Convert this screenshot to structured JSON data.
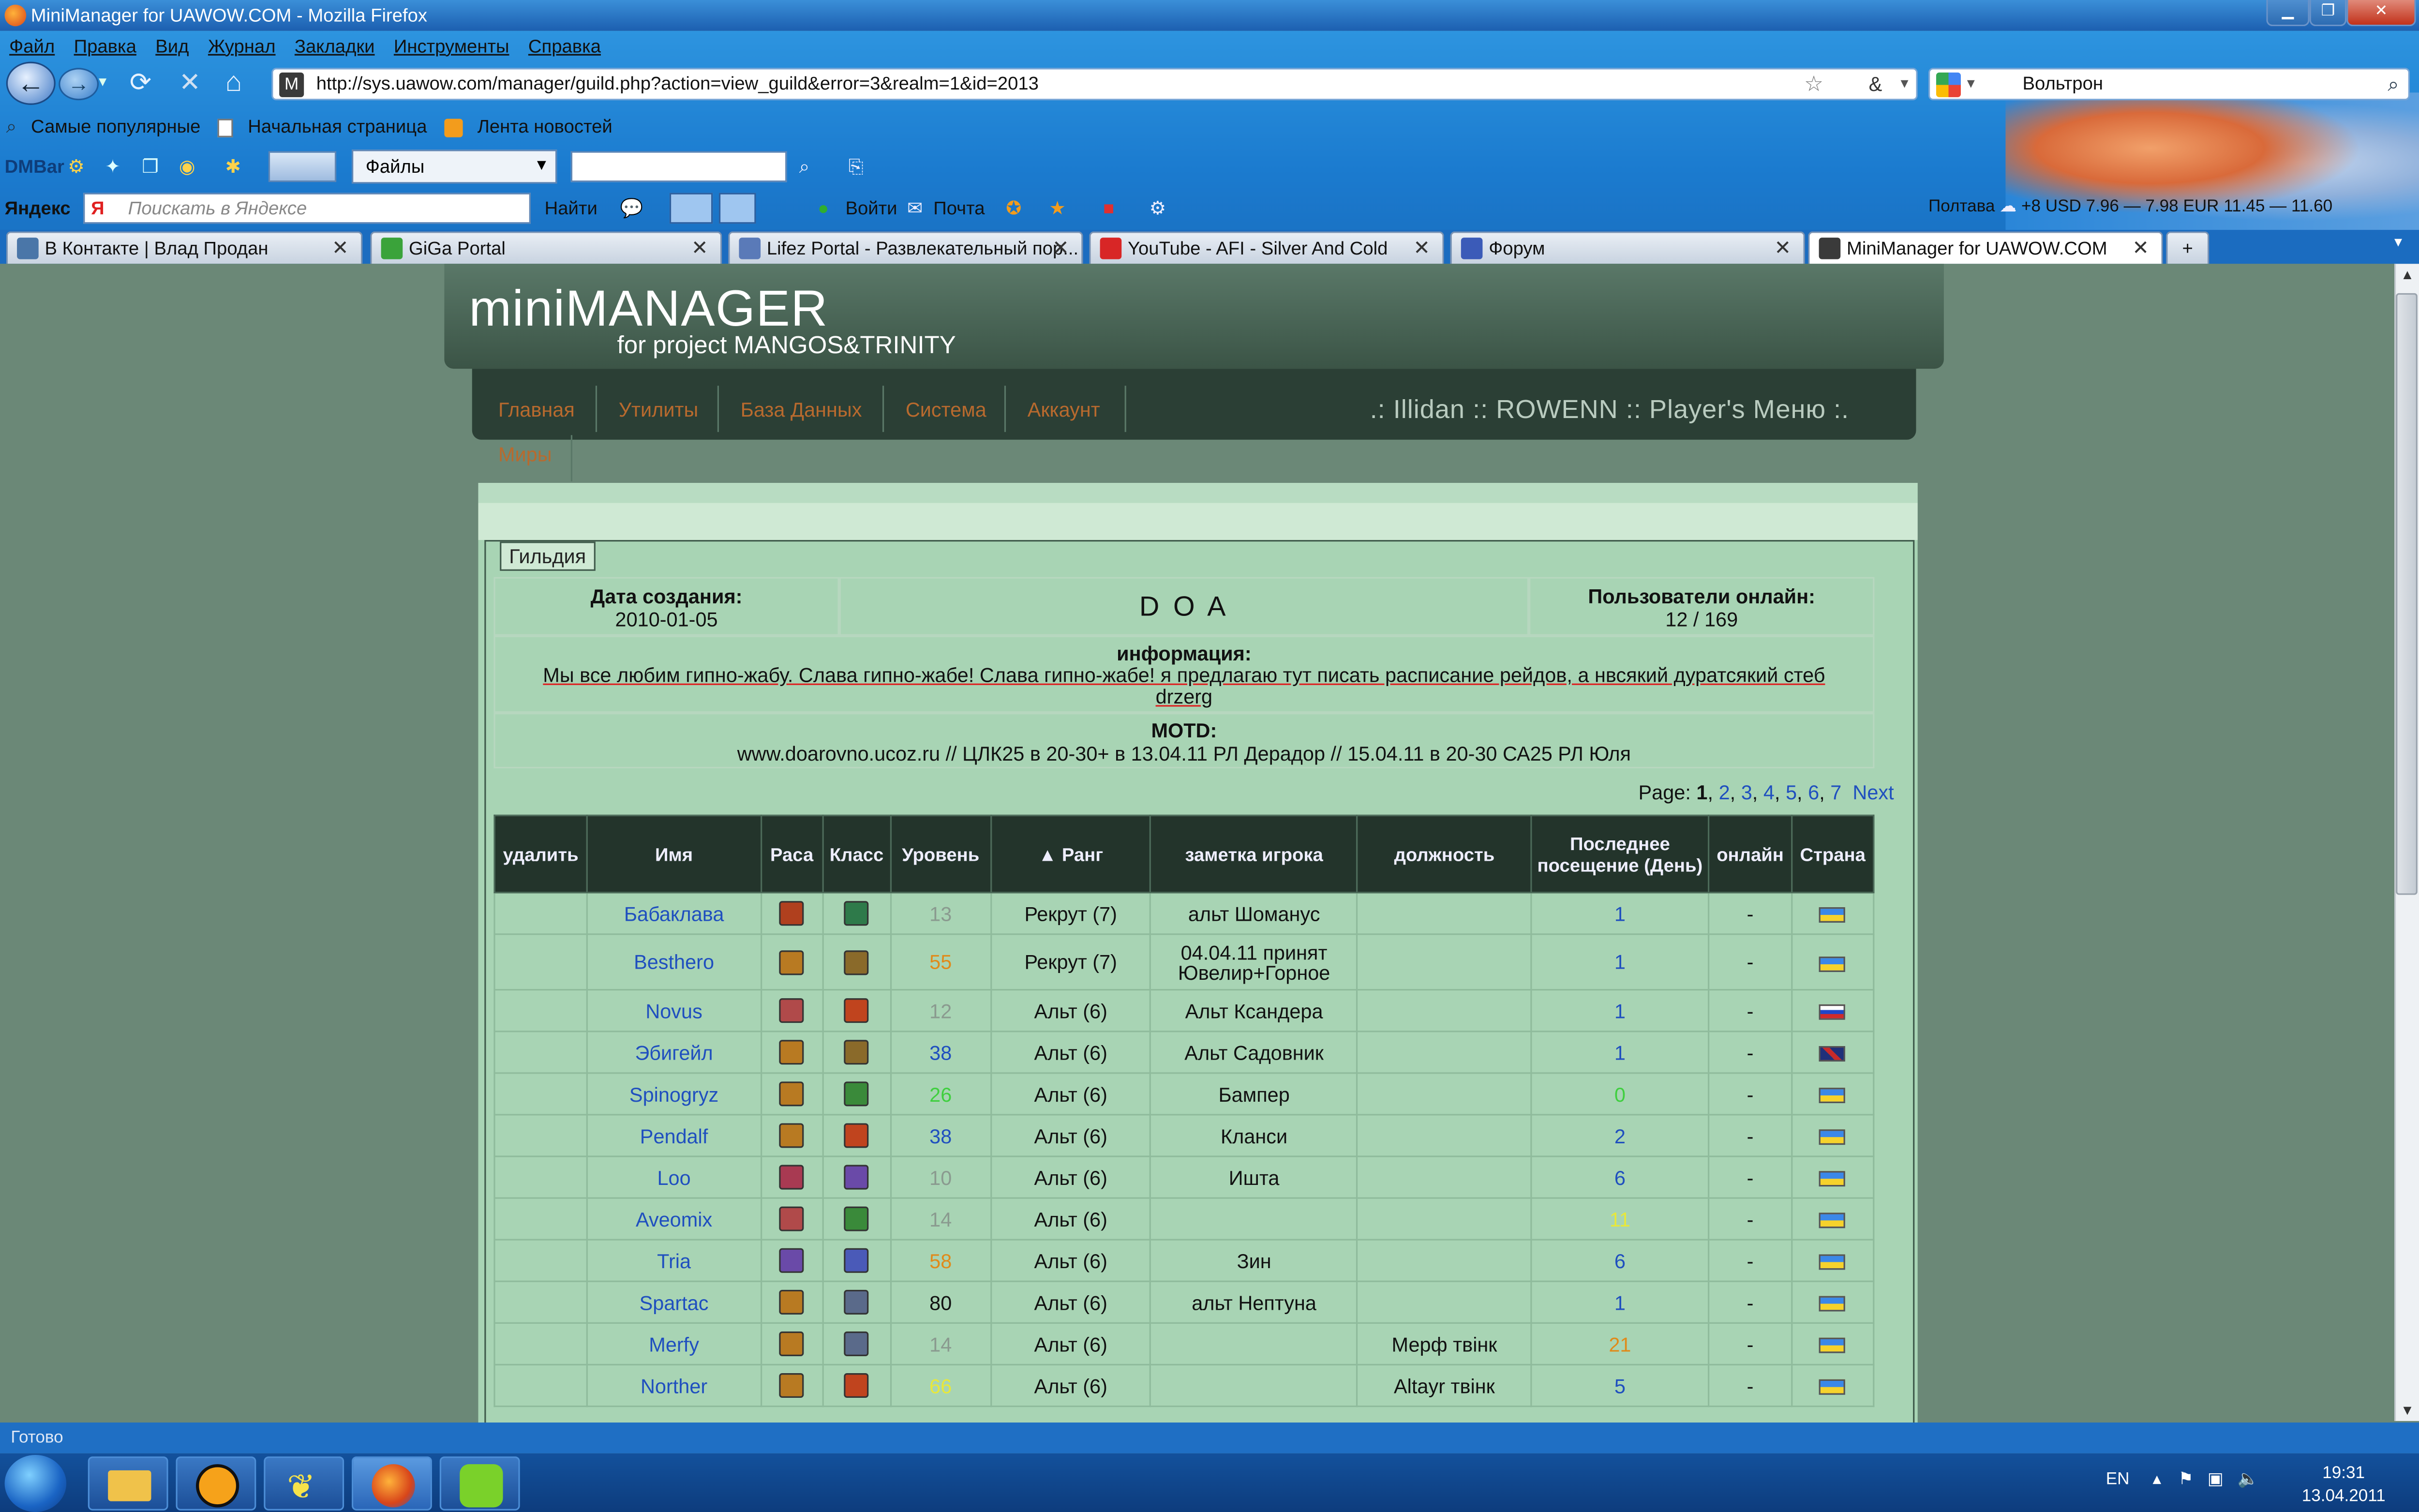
{
  "window": {
    "title": "MiniManager for UAWOW.COM - Mozilla Firefox"
  },
  "menu": [
    "Файл",
    "Правка",
    "Вид",
    "Журнал",
    "Закладки",
    "Инструменты",
    "Справка"
  ],
  "url": "http://sys.uawow.com/manager/guild.php?action=view_guild&error=3&realm=1&id=2013",
  "search_engine_value": "Вольтрон",
  "bookmarks": [
    "Самые популярные",
    "Начальная страница",
    "Лента новостей"
  ],
  "dmbar": {
    "label": "DMBar",
    "dropdown": "Файлы"
  },
  "yandex": {
    "label": "Яндекс",
    "placeholder": "Поискать в Яндексе",
    "find": "Найти",
    "login": "Войти",
    "mail": "Почта"
  },
  "weather": {
    "city": "Полтава",
    "temp": "+8",
    "usd": "USD 7.96 — 7.98",
    "eur": "EUR 11.45 — 11.60"
  },
  "tabs": [
    {
      "label": "В Контакте | Влад Продан",
      "active": false
    },
    {
      "label": "GiGa Portal",
      "active": false
    },
    {
      "label": "Lifez Portal - Развлекательный пор...",
      "active": false
    },
    {
      "label": "YouTube - AFI - Silver And Cold",
      "active": false
    },
    {
      "label": "Форум",
      "active": false
    },
    {
      "label": "MiniManager for UAWOW.COM",
      "active": true
    }
  ],
  "site": {
    "logo_title": "miniMANAGER",
    "logo_sub": "for project MANGOS&TRINITY",
    "nav": [
      "Главная",
      "Утилиты",
      "База Данных",
      "Система",
      "Аккаунт"
    ],
    "nav2": "Миры",
    "player_menu": ".: Illidan :: ROWENN :: Player's Меню :."
  },
  "guild": {
    "legend": "Гильдия",
    "created_label": "Дата создания:",
    "created_value": "2010-01-05",
    "name": "D O A",
    "online_label": "Пользователи онлайн:",
    "online_value": "12 / 169",
    "info_label": "информация:",
    "info_text": "Мы все любим гипно-жабу. Слава гипно-жабе! Слава гипно-жабе! я предлагаю тут писать расписание рейдов, а нвсякий дуратсякий стеб drzerg",
    "motd_label": "MOTD:",
    "motd_text": "www.doarovno.ucoz.ru // ЦЛК25 в 20-30+ в 13.04.11 РЛ Дерадор // 15.04.11 в 20-30 СА25 РЛ Юля"
  },
  "pagination": {
    "label": "Page:",
    "pages": [
      "1",
      "2",
      "3",
      "4",
      "5",
      "6",
      "7"
    ],
    "current": "1",
    "next": "Next"
  },
  "columns": [
    "удалить",
    "Имя",
    "Раса",
    "Класс",
    "Уровень",
    "▲ Ранг",
    "заметка игрока",
    "должность",
    "Последнее посещение (День)",
    "онлайн",
    "Страна"
  ],
  "members": [
    {
      "name": "Бабаклава",
      "level": "13",
      "level_color": "#8a9a8f",
      "rank": "Рекрут (7)",
      "note": "альт Шоманус",
      "officer": "",
      "last": "1",
      "last_color": "#1f4fbf",
      "online": "-",
      "flag": "ua",
      "race_color": "#b0401e",
      "class_color": "#2e7a4a"
    },
    {
      "name": "Besthero",
      "level": "55",
      "level_color": "#e08a1a",
      "rank": "Рекрут (7)",
      "note": "04.04.11 принят Ювелир+Горное",
      "officer": "",
      "last": "1",
      "last_color": "#1f4fbf",
      "online": "-",
      "flag": "ua",
      "race_color": "#b87a22",
      "class_color": "#8a6a2a"
    },
    {
      "name": "Novus",
      "level": "12",
      "level_color": "#8a9a8f",
      "rank": "Альт (6)",
      "note": "Альт Ксандера",
      "officer": "",
      "last": "1",
      "last_color": "#1f4fbf",
      "online": "-",
      "flag": "ru",
      "race_color": "#b04a4a",
      "class_color": "#c0441e"
    },
    {
      "name": "Эбигейл",
      "level": "38",
      "level_color": "#1f4fbf",
      "rank": "Альт (6)",
      "note": "Альт Садовник",
      "officer": "",
      "last": "1",
      "last_color": "#1f4fbf",
      "online": "-",
      "flag": "gb",
      "race_color": "#b87a22",
      "class_color": "#8a6a2a"
    },
    {
      "name": "Spinogryz",
      "level": "26",
      "level_color": "#3fcf3f",
      "rank": "Альт (6)",
      "note": "Бампер",
      "officer": "",
      "last": "0",
      "last_color": "#3fcf3f",
      "online": "-",
      "flag": "ua",
      "race_color": "#b87a22",
      "class_color": "#3a8a3a"
    },
    {
      "name": "Pendalf",
      "level": "38",
      "level_color": "#1f4fbf",
      "rank": "Альт (6)",
      "note": "Кланси",
      "officer": "",
      "last": "2",
      "last_color": "#1f4fbf",
      "online": "-",
      "flag": "ua",
      "race_color": "#b87a22",
      "class_color": "#c0441e"
    },
    {
      "name": "Loo",
      "level": "10",
      "level_color": "#8a9a8f",
      "rank": "Альт (6)",
      "note": "Ишта",
      "officer": "",
      "last": "6",
      "last_color": "#1f4fbf",
      "online": "-",
      "flag": "ua",
      "race_color": "#a83a52",
      "class_color": "#6a4aa8"
    },
    {
      "name": "Aveomix",
      "level": "14",
      "level_color": "#8a9a8f",
      "rank": "Альт (6)",
      "note": "",
      "officer": "",
      "last": "11",
      "last_color": "#e8e83a",
      "online": "-",
      "flag": "ua",
      "race_color": "#b04a4a",
      "class_color": "#3a8a3a"
    },
    {
      "name": "Tria",
      "level": "58",
      "level_color": "#e08a1a",
      "rank": "Альт (6)",
      "note": "Зин",
      "officer": "",
      "last": "6",
      "last_color": "#1f4fbf",
      "online": "-",
      "flag": "ua",
      "race_color": "#6a4aa8",
      "class_color": "#4a5ab8"
    },
    {
      "name": "Spartac",
      "level": "80",
      "level_color": "#111111",
      "rank": "Альт (6)",
      "note": "альт Нептуна",
      "officer": "",
      "last": "1",
      "last_color": "#1f4fbf",
      "online": "-",
      "flag": "ua",
      "race_color": "#b87a22",
      "class_color": "#5a6a8a"
    },
    {
      "name": "Merfy",
      "level": "14",
      "level_color": "#8a9a8f",
      "rank": "Альт (6)",
      "note": "",
      "officer": "Мерф твінк",
      "last": "21",
      "last_color": "#e08a1a",
      "online": "-",
      "flag": "ua",
      "race_color": "#b87a22",
      "class_color": "#5a6a8a"
    },
    {
      "name": "Norther",
      "level": "66",
      "level_color": "#e8e83a",
      "rank": "Альт (6)",
      "note": "",
      "officer": "Altayr твінк",
      "last": "5",
      "last_color": "#1f4fbf",
      "online": "-",
      "flag": "ua",
      "race_color": "#b87a22",
      "class_color": "#c0441e"
    }
  ],
  "status": "Готово",
  "taskbar": {
    "lang": "EN",
    "time": "19:31",
    "date": "13.04.2011"
  }
}
